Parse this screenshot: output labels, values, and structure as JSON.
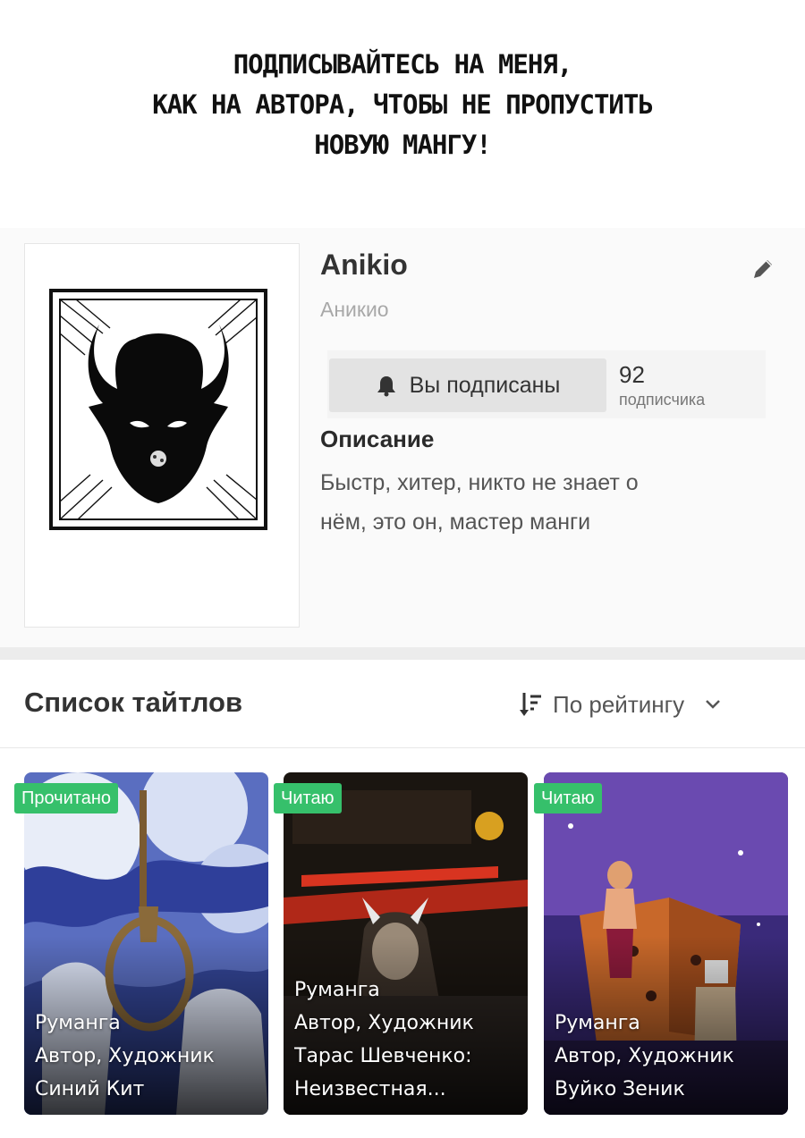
{
  "caption": {
    "line1": "Подписывайтесь на меня,",
    "line2": "как на автора, чтобы не пропустить",
    "line3": "новую мангу!"
  },
  "profile": {
    "name": "Anikio",
    "alt_name": "Аникио",
    "subscribe_label": "Вы подписаны",
    "subscribers_count": "92",
    "subscribers_word": "подписчика",
    "description_title": "Описание",
    "description_line1": "Быстр, хитер, никто не знает о",
    "description_line2": "нём, это он, мастер манги",
    "icons": [
      "demon-avatar",
      "pencil-icon",
      "bell-icon"
    ]
  },
  "titles": {
    "heading": "Список тайтлов",
    "sort_label": "По рейтингу",
    "items": [
      {
        "badge": "Прочитано",
        "line1": "Руманга",
        "line2": "Автор, Художник",
        "line3": "Синий Кит",
        "badge_color": "#36c06b"
      },
      {
        "badge": "Читаю",
        "line1": "Руманга",
        "line2": "Автор, Художник",
        "line3": "Тарас Шевченко:",
        "line4": "Неизвестная...",
        "badge_color": "#36c06b"
      },
      {
        "badge": "Читаю",
        "line1": "Руманга",
        "line2": "Автор, Художник",
        "line3": "Вуйко Зеник",
        "badge_color": "#36c06b"
      }
    ]
  },
  "colors": {
    "accent": "#36c06b",
    "background": "#ffffff",
    "panel": "#fafafa"
  }
}
